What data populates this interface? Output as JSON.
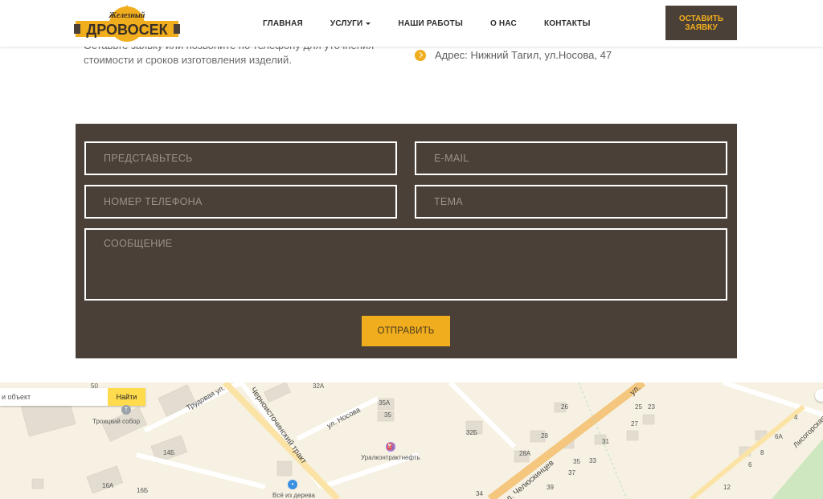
{
  "header": {
    "logo_top": "Железный",
    "logo_main": "ДРОВОСЕК",
    "nav": [
      {
        "label": "ГЛАВНАЯ"
      },
      {
        "label": "УСЛУГИ"
      },
      {
        "label": "НАШИ РАБОТЫ"
      },
      {
        "label": "О НАС"
      },
      {
        "label": "КОНТАКТЫ"
      }
    ],
    "cta_label": "ОСТАВИТЬ ЗАЯВКУ",
    "colors": {
      "accent": "#f0ad1d",
      "dark": "#4a4038"
    }
  },
  "intro": {
    "text": "Оставьте заявку или позвоните по телефону для уточнения стоимости и сроков изготовления изделий.",
    "address": "Адрес: Нижний Тагил, ул.Носова, 47"
  },
  "form": {
    "name_placeholder": "ПРЕДСТАВЬТЕСЬ",
    "email_placeholder": "E-MAIL",
    "phone_placeholder": "НОМЕР ТЕЛЕФОНА",
    "topic_placeholder": "ТЕМА",
    "message_placeholder": "СООБЩЕНИЕ",
    "submit_label": "ОТПРАВИТЬ"
  },
  "map": {
    "search_placeholder": "и объект",
    "search_button": "Найти",
    "labels": {
      "troitsky": "Троицкий собор",
      "uralkontrakt": "Уралконтрактнефть",
      "vse_iz_dereva": "Всё из дерева",
      "trudovaya": "Трудовая ул.",
      "nosova": "ул. Носова",
      "chernoist": "Черноисточинский тракт",
      "chelyuskintsev": "л. Челюскинцев",
      "lisogorskaya": "Лисогорская ул.",
      "ul": "ул."
    },
    "numbers": [
      "50",
      "32А",
      "35А",
      "35",
      "26",
      "25",
      "23",
      "27",
      "28",
      "31",
      "32Б",
      "28А",
      "35",
      "33",
      "37",
      "34",
      "39",
      "14Б",
      "16А",
      "16Б",
      "12",
      "4",
      "6А",
      "8",
      "6"
    ]
  }
}
